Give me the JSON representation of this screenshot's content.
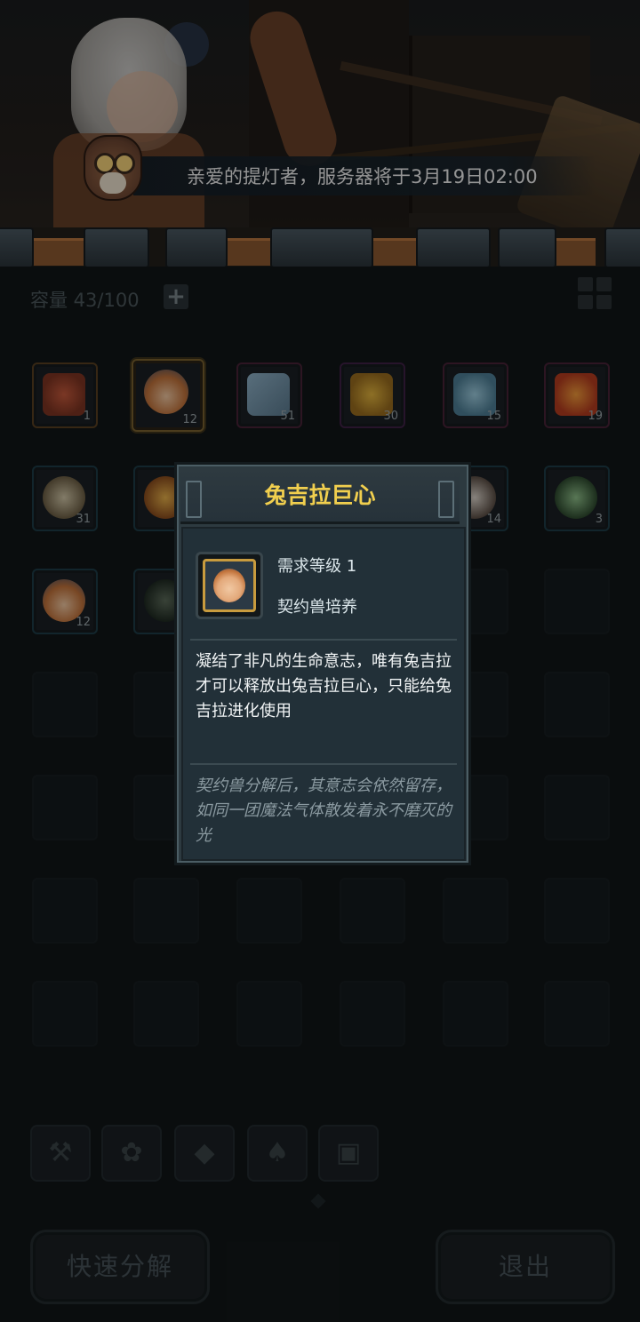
{
  "notice": {
    "text": "亲爱的提灯者，服务器将于3月19日02:00"
  },
  "inventory": {
    "capacity_label": "容量 43/100",
    "plus_glyph": "+",
    "items_row1": [
      {
        "count": "1"
      },
      {
        "count": "12"
      },
      {
        "count": "51"
      },
      {
        "count": "30"
      },
      {
        "count": "15"
      },
      {
        "count": "19"
      }
    ],
    "items_row2": [
      {
        "count": "31"
      },
      {
        "count": ""
      },
      {
        "count": "14"
      },
      {
        "count": "3"
      }
    ],
    "items_row3": [
      {
        "count": "12"
      },
      {
        "count": ""
      }
    ]
  },
  "categories": [
    {
      "icon": "hammer-icon"
    },
    {
      "icon": "paw-icon"
    },
    {
      "icon": "gem-icon"
    },
    {
      "icon": "leaf-icon"
    },
    {
      "icon": "chest-icon"
    }
  ],
  "buttons": {
    "quick_decompose": "快速分解",
    "exit": "退出"
  },
  "popup": {
    "title": "兔吉拉巨心",
    "required_level": "需求等级 1",
    "category": "契约兽培养",
    "description": "凝结了非凡的生命意志，唯有兔吉拉才可以释放出兔吉拉巨心，只能给兔吉拉进化使用",
    "lore": "契约兽分解后，其意志会依然留存，如同一团魔法气体散发着永不磨灭的光"
  },
  "colors": {
    "title_gold": "#f1cf4e",
    "lore_grey": "#8b9aa1"
  }
}
